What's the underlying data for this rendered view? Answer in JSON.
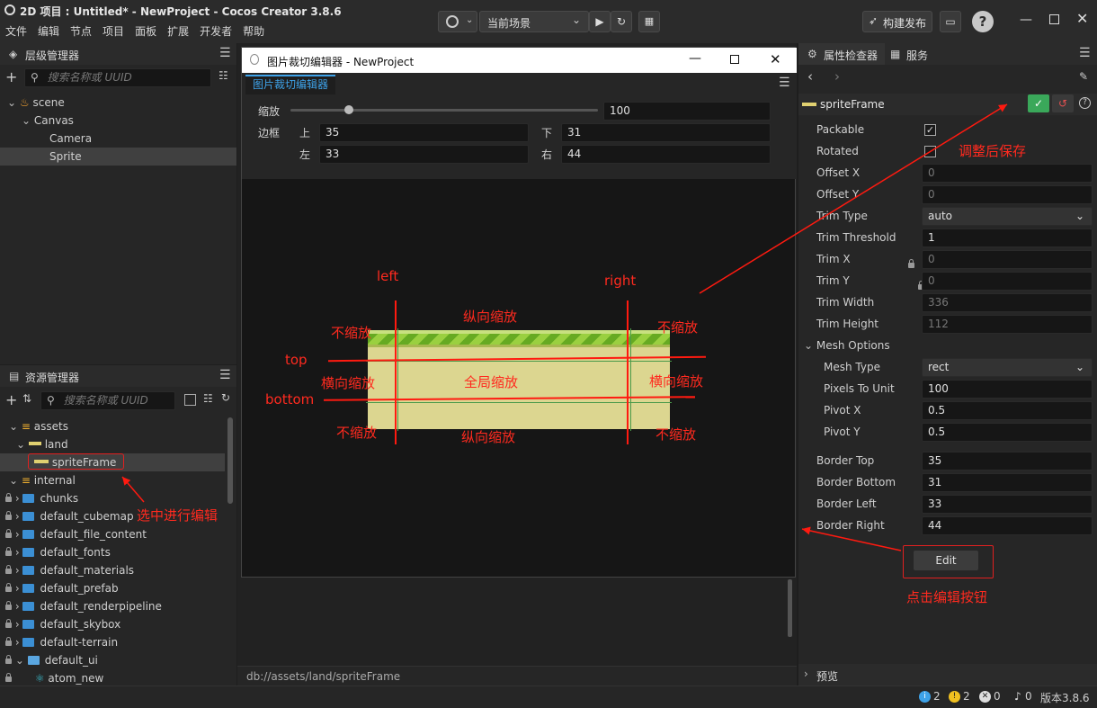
{
  "window": {
    "title": "2D 项目 : Untitled* - NewProject - Cocos Creator 3.8.6"
  },
  "menu": [
    "文件",
    "编辑",
    "节点",
    "项目",
    "面板",
    "扩展",
    "开发者",
    "帮助"
  ],
  "toolbar": {
    "scene_select": "当前场景",
    "build_label": "构建发布"
  },
  "hierarchy": {
    "title": "层级管理器",
    "search_placeholder": "搜索名称或 UUID",
    "nodes": [
      {
        "label": "scene"
      },
      {
        "label": "Canvas"
      },
      {
        "label": "Camera"
      },
      {
        "label": "Sprite"
      }
    ]
  },
  "assets": {
    "title": "资源管理器",
    "search_placeholder": "搜索名称或 UUID",
    "items": [
      {
        "label": "assets"
      },
      {
        "label": "land"
      },
      {
        "label": "spriteFrame"
      },
      {
        "label": "internal"
      },
      {
        "label": "chunks"
      },
      {
        "label": "default_cubemap"
      },
      {
        "label": "default_file_content"
      },
      {
        "label": "default_fonts"
      },
      {
        "label": "default_materials"
      },
      {
        "label": "default_prefab"
      },
      {
        "label": "default_renderpipeline"
      },
      {
        "label": "default_skybox"
      },
      {
        "label": "default-terrain"
      },
      {
        "label": "default_ui"
      },
      {
        "label": "atom_new"
      }
    ]
  },
  "editor_window": {
    "title": "图片裁切编辑器 - NewProject",
    "tab": "图片裁切编辑器",
    "zoom_label": "缩放",
    "zoom_value": "100",
    "zoom_fraction": 0.19,
    "border_label": "边框",
    "top_label": "上",
    "top_value": "35",
    "bottom_label": "下",
    "bottom_value": "31",
    "left_label": "左",
    "left_value": "33",
    "right_label": "右",
    "right_value": "44"
  },
  "annotations": {
    "left": "left",
    "right": "right",
    "top": "top",
    "bottom": "bottom",
    "no_scale_tl": "不缩放",
    "no_scale_tr": "不缩放",
    "no_scale_bl": "不缩放",
    "no_scale_br": "不缩放",
    "vertical_top": "纵向缩放",
    "vertical_bottom": "纵向缩放",
    "horizontal_left": "横向缩放",
    "horizontal_right": "横向缩放",
    "global": "全局缩放",
    "save_hint": "调整后保存",
    "select_hint": "选中进行编辑",
    "edit_hint": "点击编辑按钮"
  },
  "status_path": "db://assets/land/spriteFrame",
  "inspector": {
    "tab_inspector": "属性检查器",
    "tab_service": "服务",
    "asset_name": "spriteFrame",
    "props": [
      {
        "label": "Packable",
        "checked": true
      },
      {
        "label": "Rotated",
        "checked": false
      }
    ],
    "fields": [
      {
        "label": "Offset X",
        "value": "0"
      },
      {
        "label": "Offset Y",
        "value": "0"
      },
      {
        "label": "Trim Type",
        "value": "auto"
      },
      {
        "label": "Trim Threshold",
        "value": "1"
      },
      {
        "label": "Trim X",
        "value": "0"
      },
      {
        "label": "Trim Y",
        "value": "0"
      },
      {
        "label": "Trim Width",
        "value": "336"
      },
      {
        "label": "Trim Height",
        "value": "112"
      },
      {
        "label": "Mesh Options",
        "value": ""
      },
      {
        "label": "Mesh Type",
        "value": "rect"
      },
      {
        "label": "Pixels To Unit",
        "value": "100"
      },
      {
        "label": "Pivot X",
        "value": "0.5"
      },
      {
        "label": "Pivot Y",
        "value": "0.5"
      },
      {
        "label": "Border Top",
        "value": "35"
      },
      {
        "label": "Border Bottom",
        "value": "31"
      },
      {
        "label": "Border Left",
        "value": "33"
      },
      {
        "label": "Border Right",
        "value": "44"
      }
    ],
    "edit_button": "Edit",
    "preview_label": "预览"
  },
  "statusbar": {
    "info": "2",
    "warn": "2",
    "error": "0",
    "notify": "0",
    "version": "版本3.8.6"
  },
  "colors": {
    "accent": "#3ea2e8",
    "annotation": "#ff2a1f",
    "confirm": "#3aa85a"
  }
}
